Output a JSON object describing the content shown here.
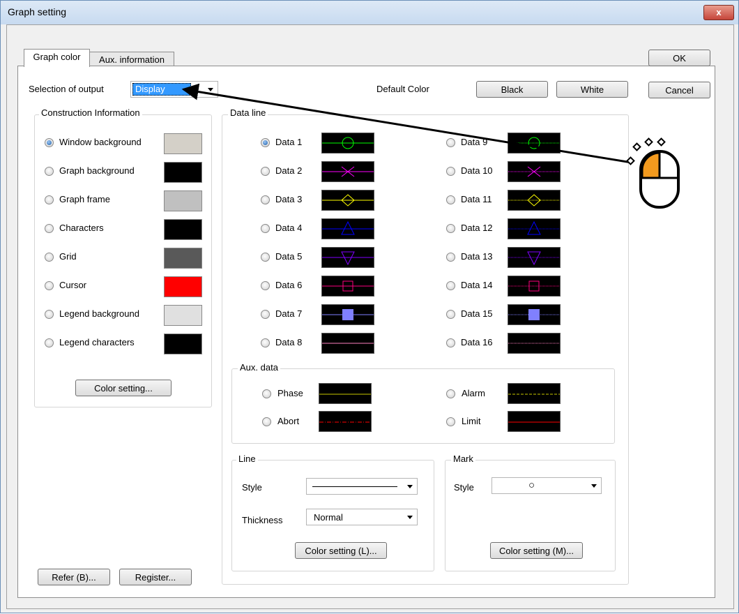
{
  "window": {
    "title": "Graph setting",
    "close_label": "x"
  },
  "tabs": [
    {
      "label": "Graph color"
    },
    {
      "label": "Aux. information"
    }
  ],
  "buttons": {
    "ok": "OK",
    "cancel": "Cancel",
    "black": "Black",
    "white": "White",
    "color_setting": "Color setting...",
    "refer": "Refer (B)...",
    "register": "Register...",
    "color_setting_l": "Color setting (L)...",
    "color_setting_m": "Color setting (M)..."
  },
  "output": {
    "label": "Selection of output",
    "value": "Display"
  },
  "default_color": {
    "label": "Default Color"
  },
  "construction": {
    "title": "Construction Information",
    "items": [
      {
        "label": "Window background",
        "color": "#d4d0c8",
        "checked": true
      },
      {
        "label": "Graph background",
        "color": "#000000"
      },
      {
        "label": "Graph frame",
        "color": "#c0c0c0"
      },
      {
        "label": "Characters",
        "color": "#000000"
      },
      {
        "label": "Grid",
        "color": "#595959"
      },
      {
        "label": "Cursor",
        "color": "#ff0000"
      },
      {
        "label": "Legend background",
        "color": "#e0e0e0"
      },
      {
        "label": "Legend characters",
        "color": "#000000"
      }
    ]
  },
  "data_line": {
    "title": "Data line",
    "left": [
      {
        "label": "Data 1",
        "color": "#00ff00",
        "mark": "circle",
        "checked": true
      },
      {
        "label": "Data 2",
        "color": "#ff00ff",
        "mark": "x"
      },
      {
        "label": "Data 3",
        "color": "#ffff00",
        "mark": "diamond"
      },
      {
        "label": "Data 4",
        "color": "#0000ff",
        "mark": "triangle-up"
      },
      {
        "label": "Data 5",
        "color": "#8000ff",
        "mark": "triangle-down"
      },
      {
        "label": "Data 6",
        "color": "#ff0080",
        "mark": "square"
      },
      {
        "label": "Data 7",
        "color": "#8080ff",
        "mark": "filled-square"
      },
      {
        "label": "Data 8",
        "color": "#ff80c0",
        "mark": "none"
      }
    ],
    "right": [
      {
        "label": "Data 9",
        "color": "#00ff00",
        "mark": "circle"
      },
      {
        "label": "Data 10",
        "color": "#ff00ff",
        "mark": "x"
      },
      {
        "label": "Data 11",
        "color": "#ffff00",
        "mark": "diamond"
      },
      {
        "label": "Data 12",
        "color": "#0000ff",
        "mark": "triangle-up"
      },
      {
        "label": "Data 13",
        "color": "#8000ff",
        "mark": "triangle-down"
      },
      {
        "label": "Data 14",
        "color": "#ff0080",
        "mark": "square"
      },
      {
        "label": "Data 15",
        "color": "#8080ff",
        "mark": "filled-square"
      },
      {
        "label": "Data 16",
        "color": "#ff80c0",
        "mark": "none"
      }
    ]
  },
  "aux_data": {
    "title": "Aux. data",
    "items": [
      {
        "label": "Phase",
        "color": "#c8c800",
        "dash": "solid"
      },
      {
        "label": "Alarm",
        "color": "#c8c800",
        "dash": "dashed"
      },
      {
        "label": "Abort",
        "color": "#ff0000",
        "dash": "dashdot"
      },
      {
        "label": "Limit",
        "color": "#ff0000",
        "dash": "solid"
      }
    ]
  },
  "line_group": {
    "title": "Line",
    "style_label": "Style",
    "thickness_label": "Thickness",
    "thickness_value": "Normal"
  },
  "mark_group": {
    "title": "Mark",
    "style_label": "Style",
    "style_value": "○"
  }
}
